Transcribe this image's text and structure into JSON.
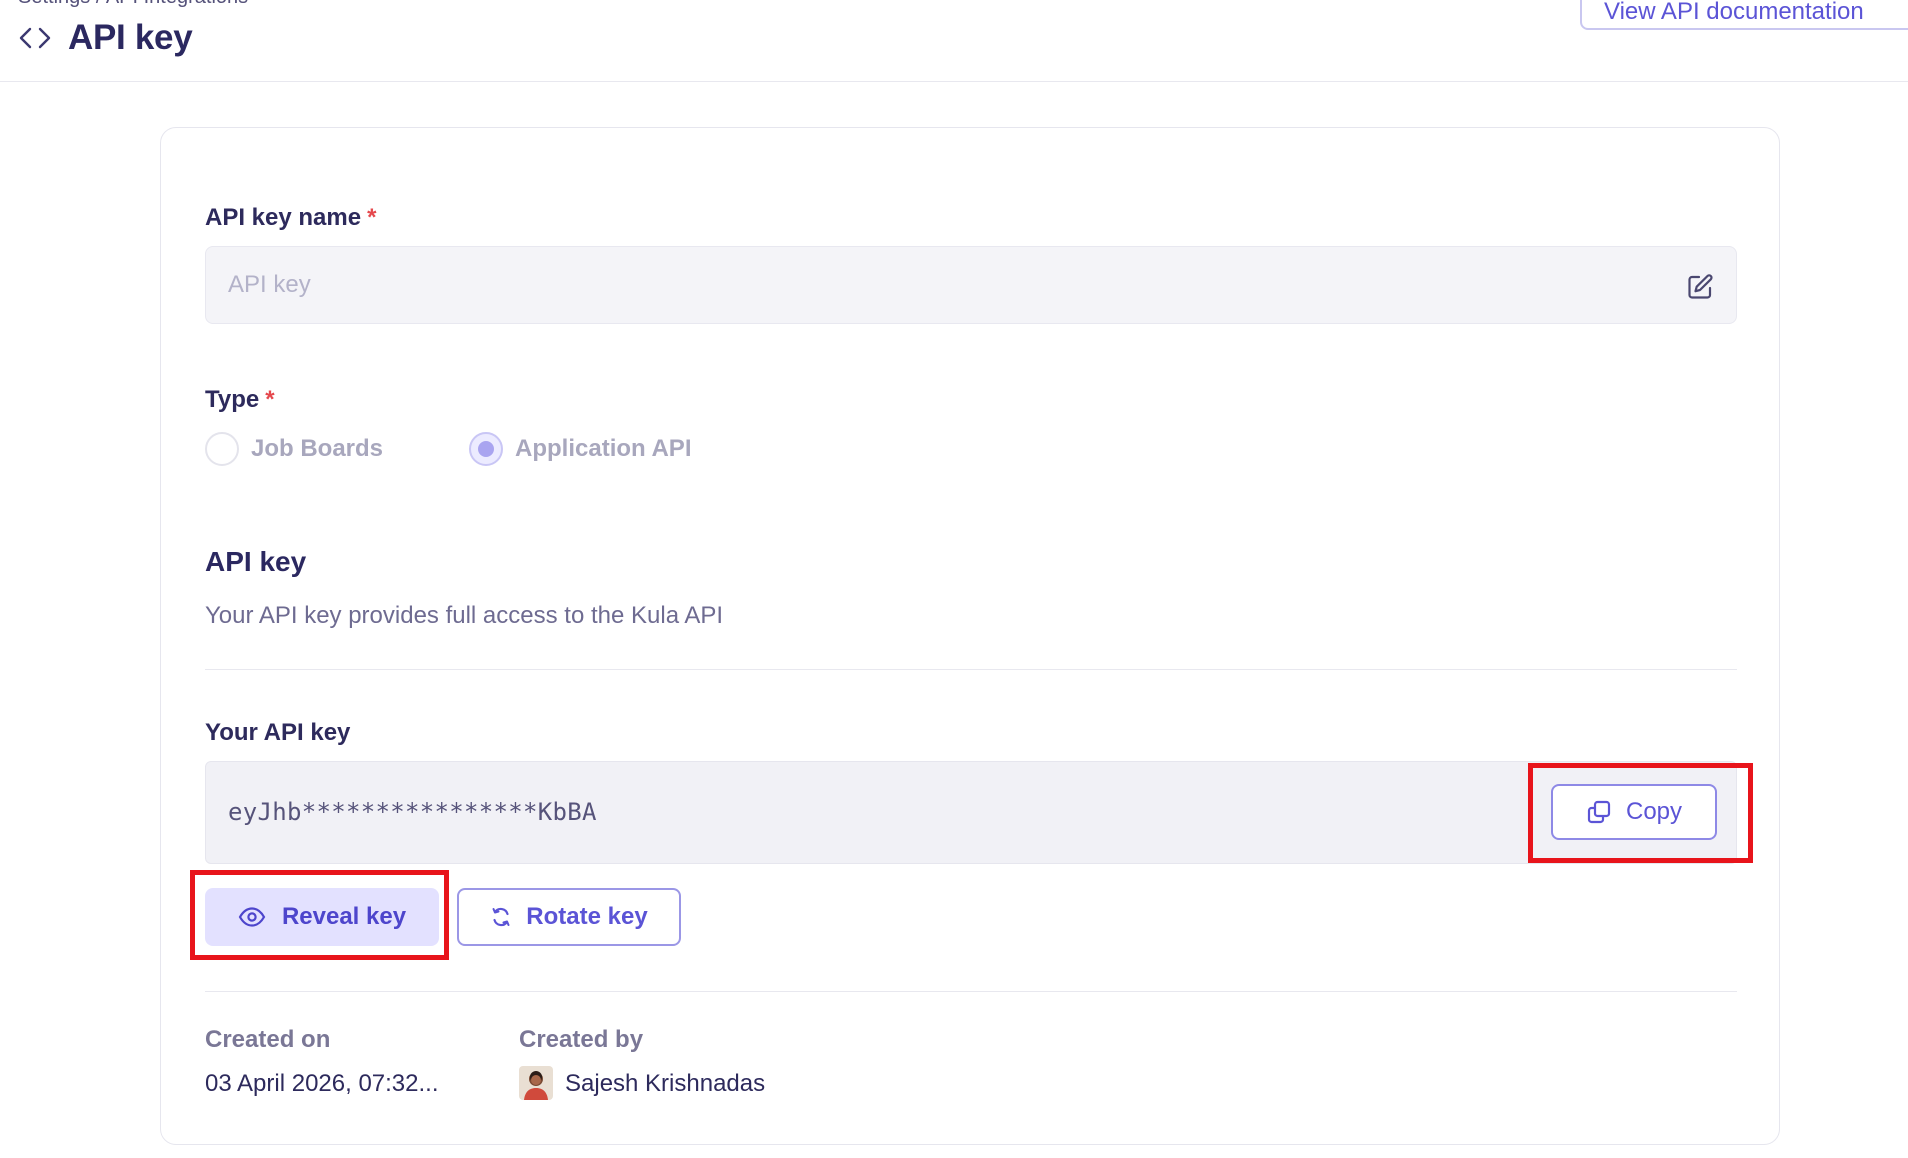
{
  "header": {
    "breadcrumb": "Settings / API Integrations",
    "title": "API key",
    "docs_button": "View API documentation"
  },
  "form": {
    "name_label": "API key name",
    "name_required": "*",
    "name_placeholder": "API key",
    "type_label": "Type",
    "type_required": "*",
    "type_options": [
      {
        "label": "Job Boards",
        "selected": false
      },
      {
        "label": "Application API",
        "selected": true
      }
    ]
  },
  "api_key_section": {
    "title": "API key",
    "description": "Your API key provides full access to the Kula API",
    "your_key_label": "Your API key",
    "masked_key": "eyJhb****************KbBA",
    "copy_label": "Copy",
    "reveal_label": "Reveal key",
    "rotate_label": "Rotate key"
  },
  "meta": {
    "created_on_label": "Created on",
    "created_on_value": "03 April 2026, 07:32...",
    "created_by_label": "Created by",
    "created_by_value": "Sajesh Krishnadas"
  },
  "colors": {
    "accent": "#5b54d6",
    "required": "#e5484d",
    "highlight": "#e8141b"
  }
}
